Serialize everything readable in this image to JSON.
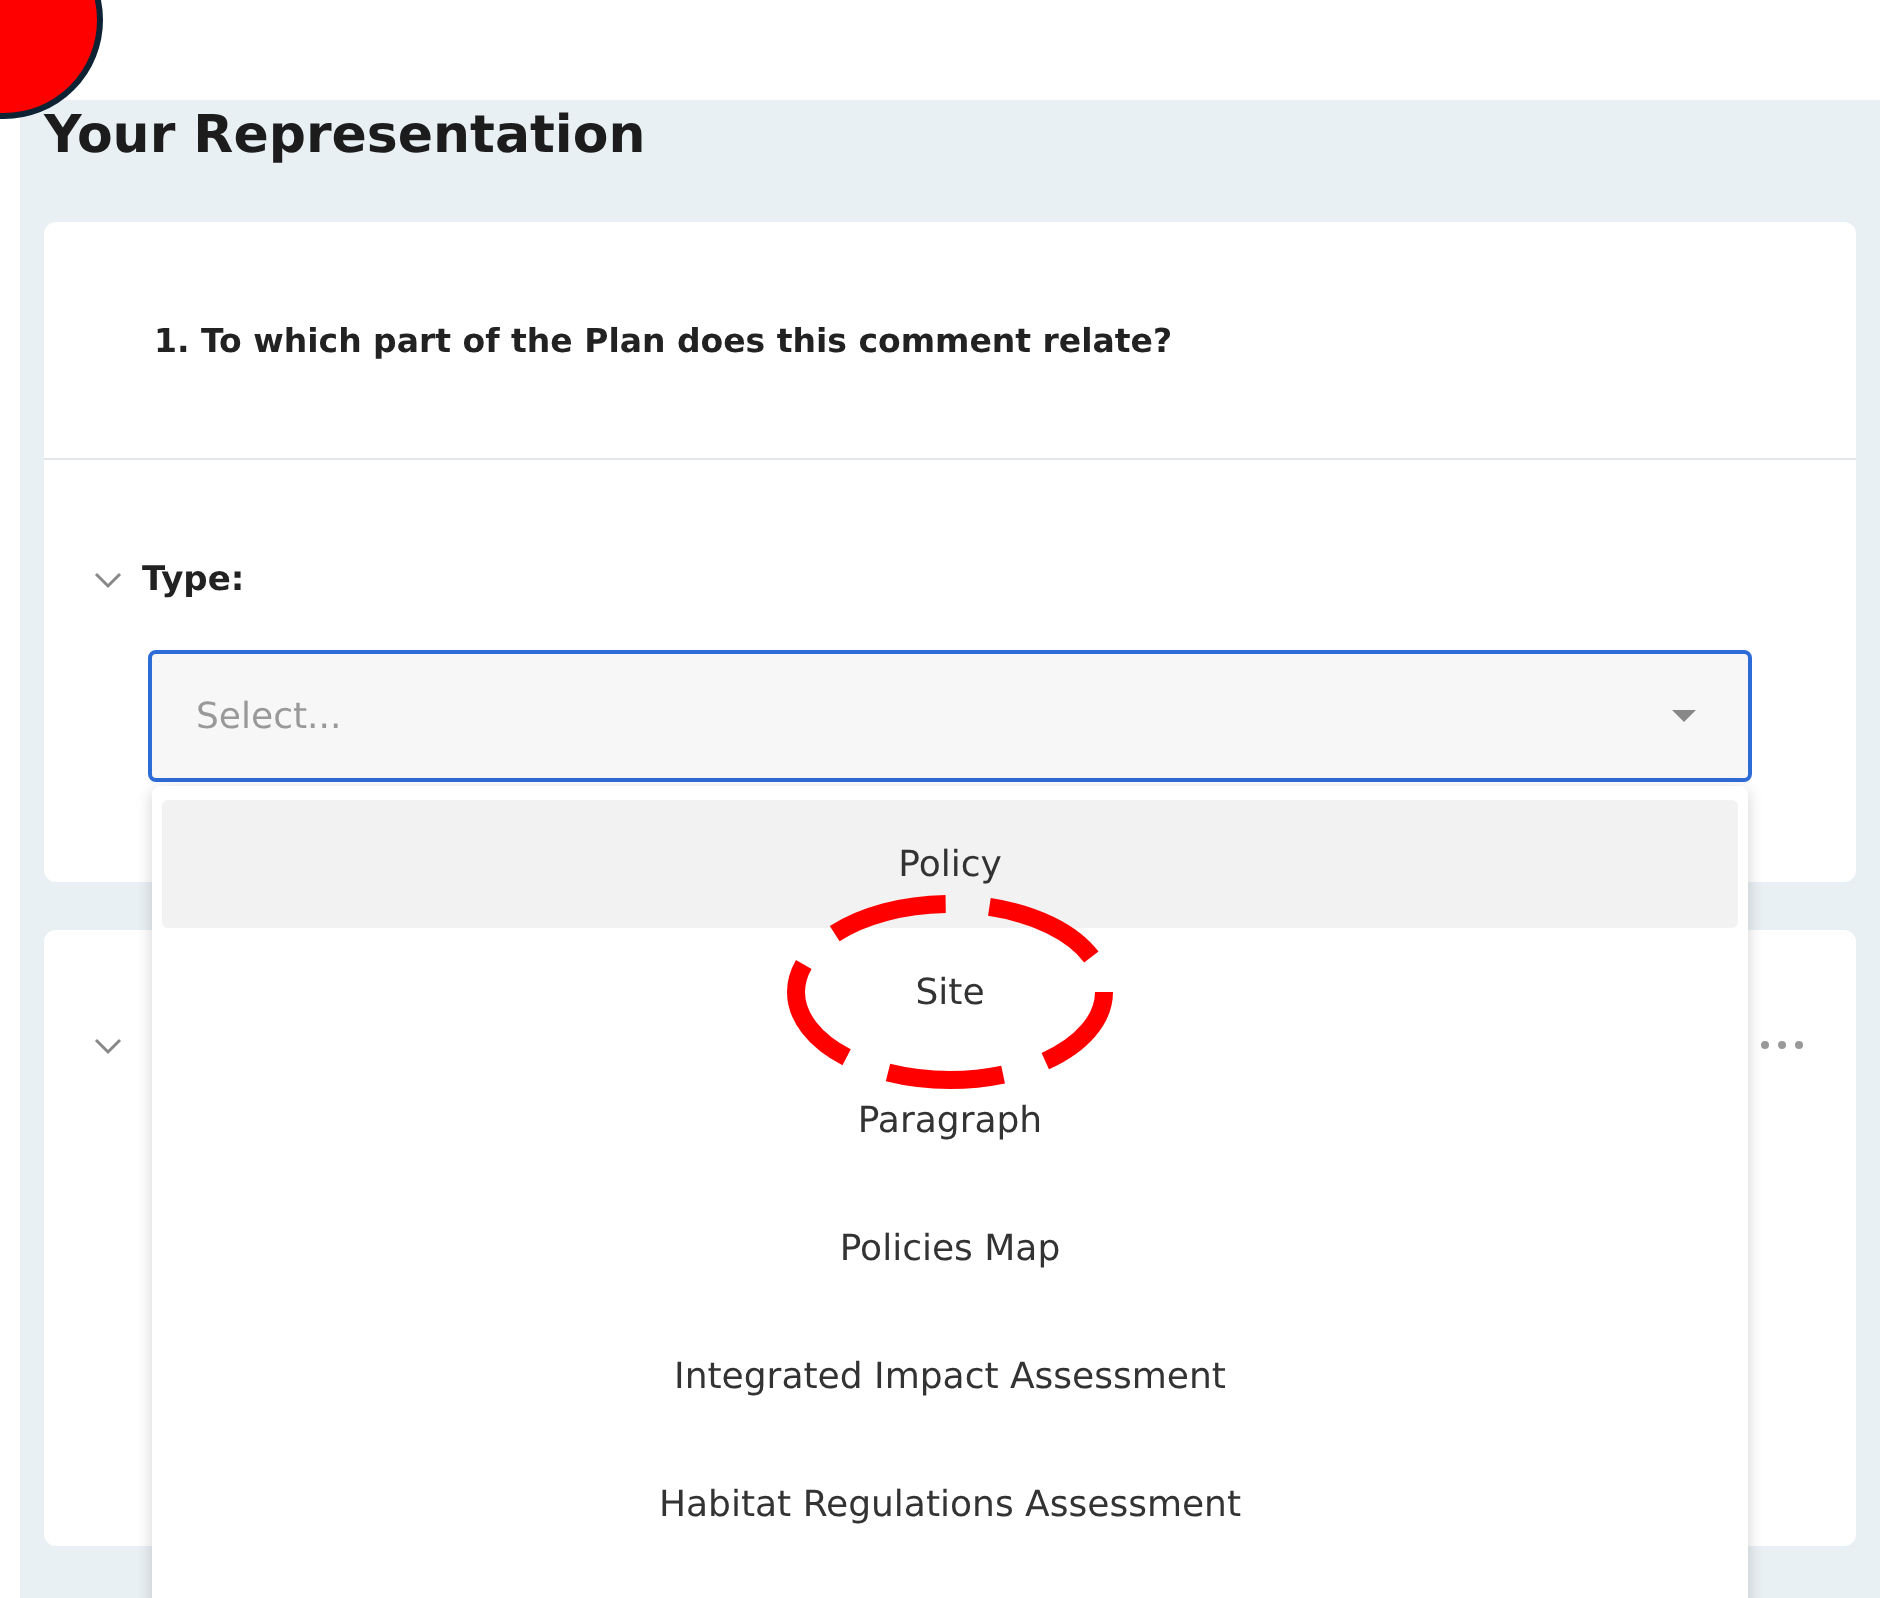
{
  "corner_marker": true,
  "heading": "Your Representation",
  "question": "1. To which part of the Plan does this comment relate?",
  "field": {
    "label": "Type:",
    "expanded": true,
    "placeholder": "Select...",
    "focused": true
  },
  "options": [
    {
      "label": "Policy",
      "selected": true,
      "circled": false
    },
    {
      "label": "Site",
      "selected": false,
      "circled": true
    },
    {
      "label": "Paragraph",
      "selected": false,
      "circled": false
    },
    {
      "label": "Policies Map",
      "selected": false,
      "circled": false
    },
    {
      "label": "Integrated Impact Assessment",
      "selected": false,
      "circled": false
    },
    {
      "label": "Habitat Regulations Assessment",
      "selected": false,
      "circled": false
    }
  ],
  "second_card": {
    "collapsed": false
  }
}
